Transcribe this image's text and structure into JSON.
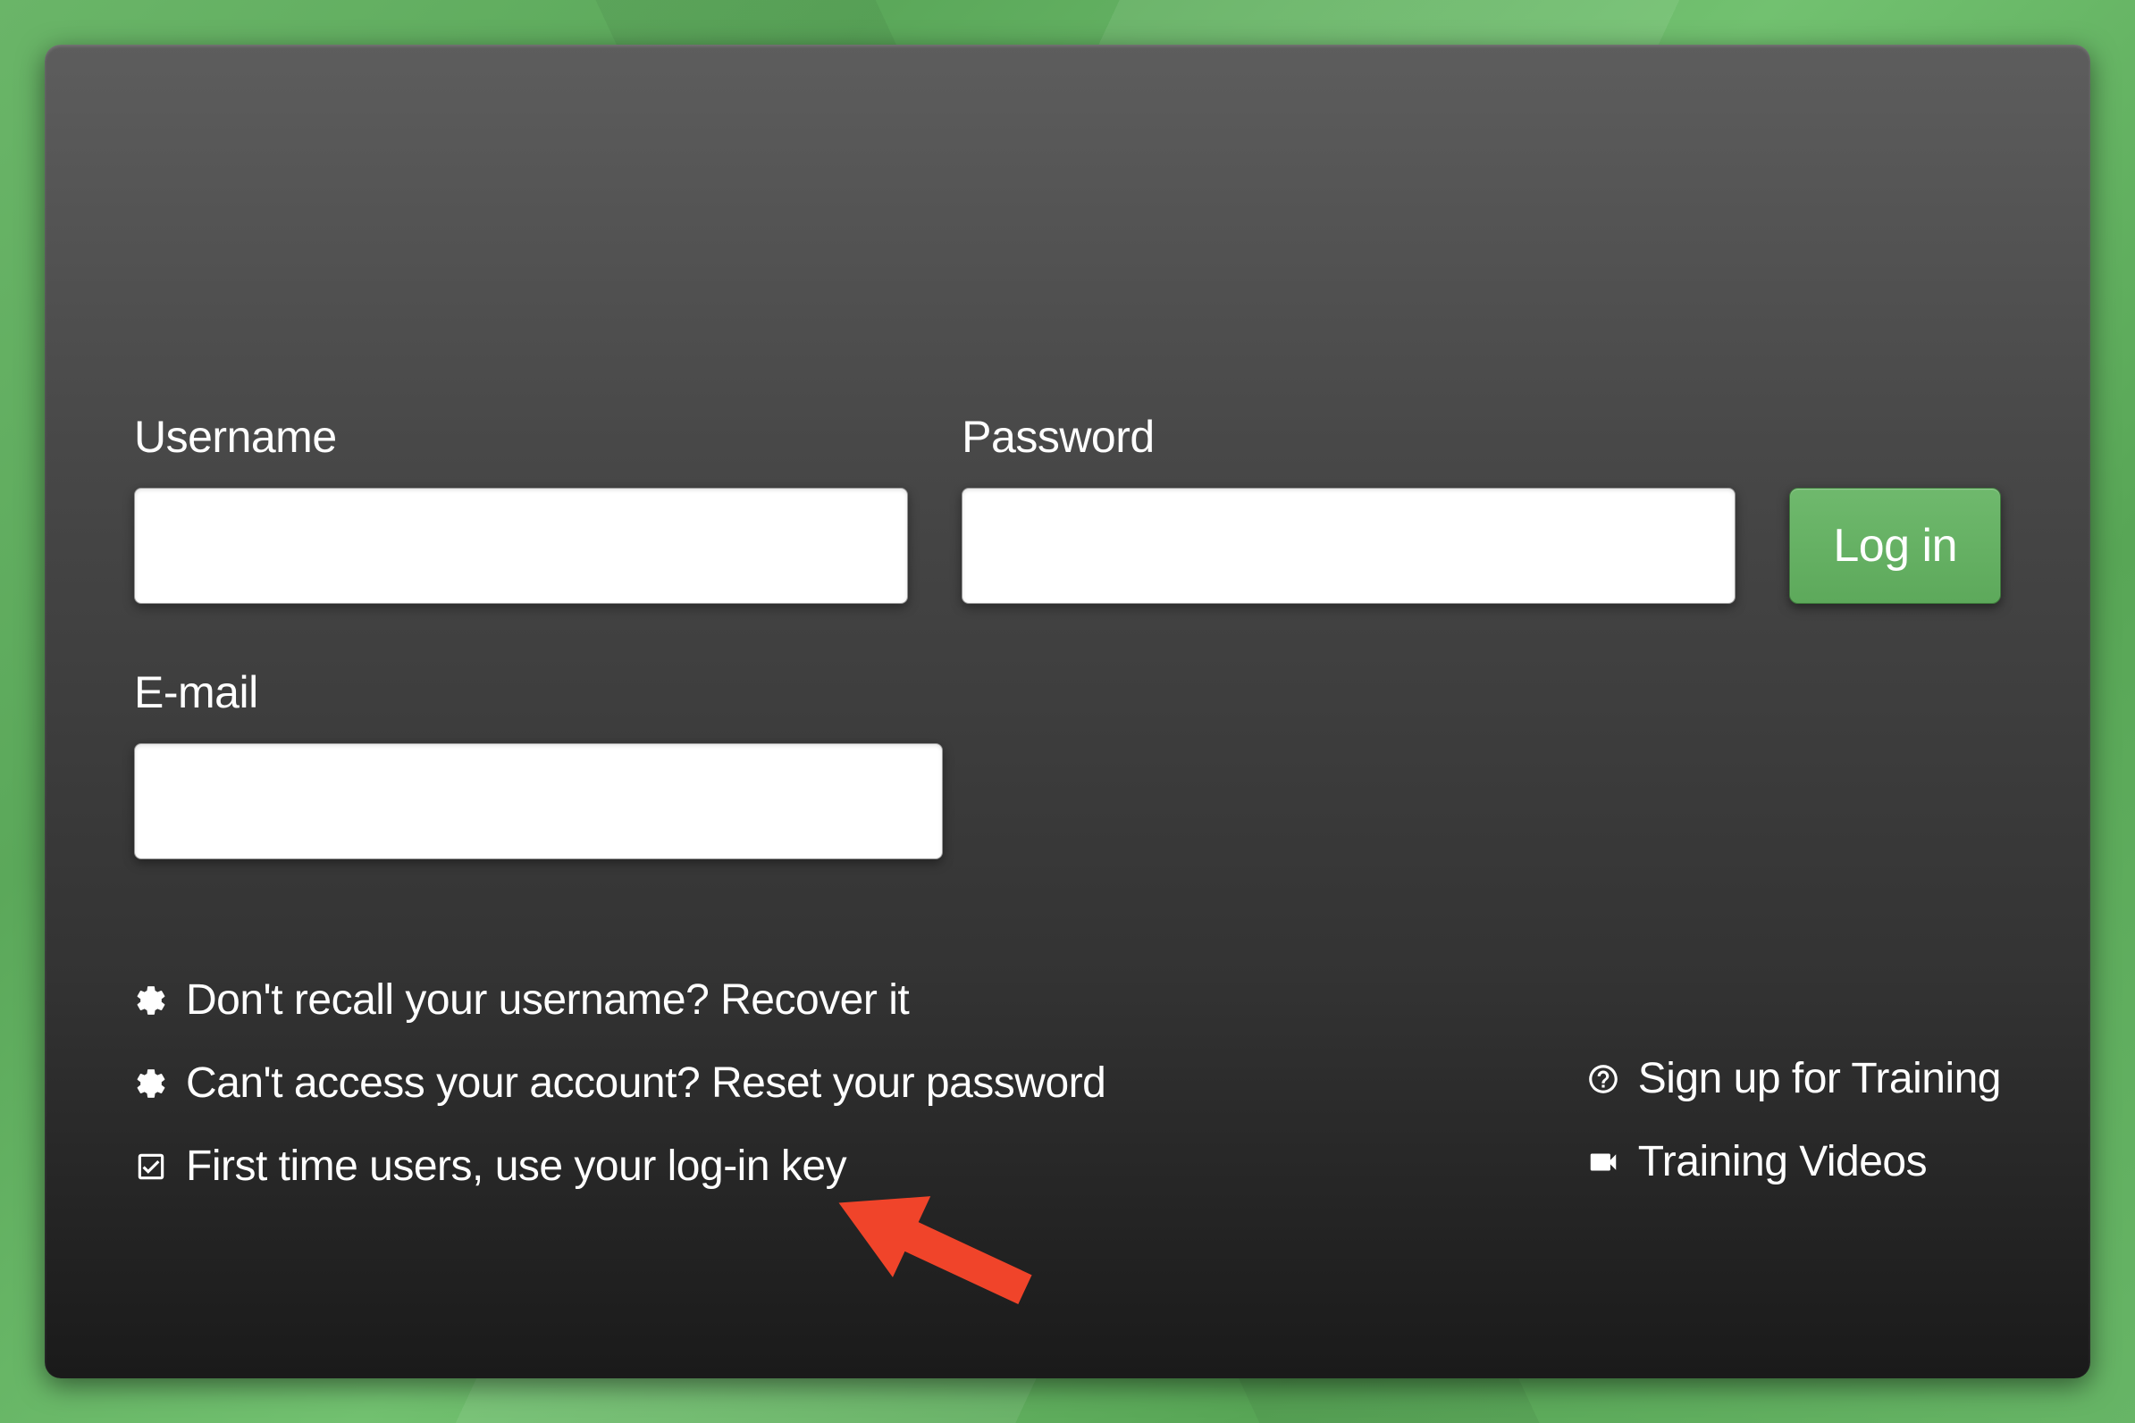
{
  "form": {
    "username_label": "Username",
    "username_value": "",
    "password_label": "Password",
    "password_value": "",
    "email_label": "E-mail",
    "email_value": "",
    "login_button_label": "Log in"
  },
  "links": {
    "recover_username": "Don't recall your username? Recover it",
    "reset_password": "Can't access your account? Reset your password",
    "login_key": "First time users, use your log-in key",
    "signup_training": "Sign up for Training",
    "training_videos": "Training Videos"
  },
  "colors": {
    "button_green": "#5da95b",
    "panel_dark": "#333333",
    "bg_green": "#6ab568",
    "arrow_red": "#f0442a"
  }
}
